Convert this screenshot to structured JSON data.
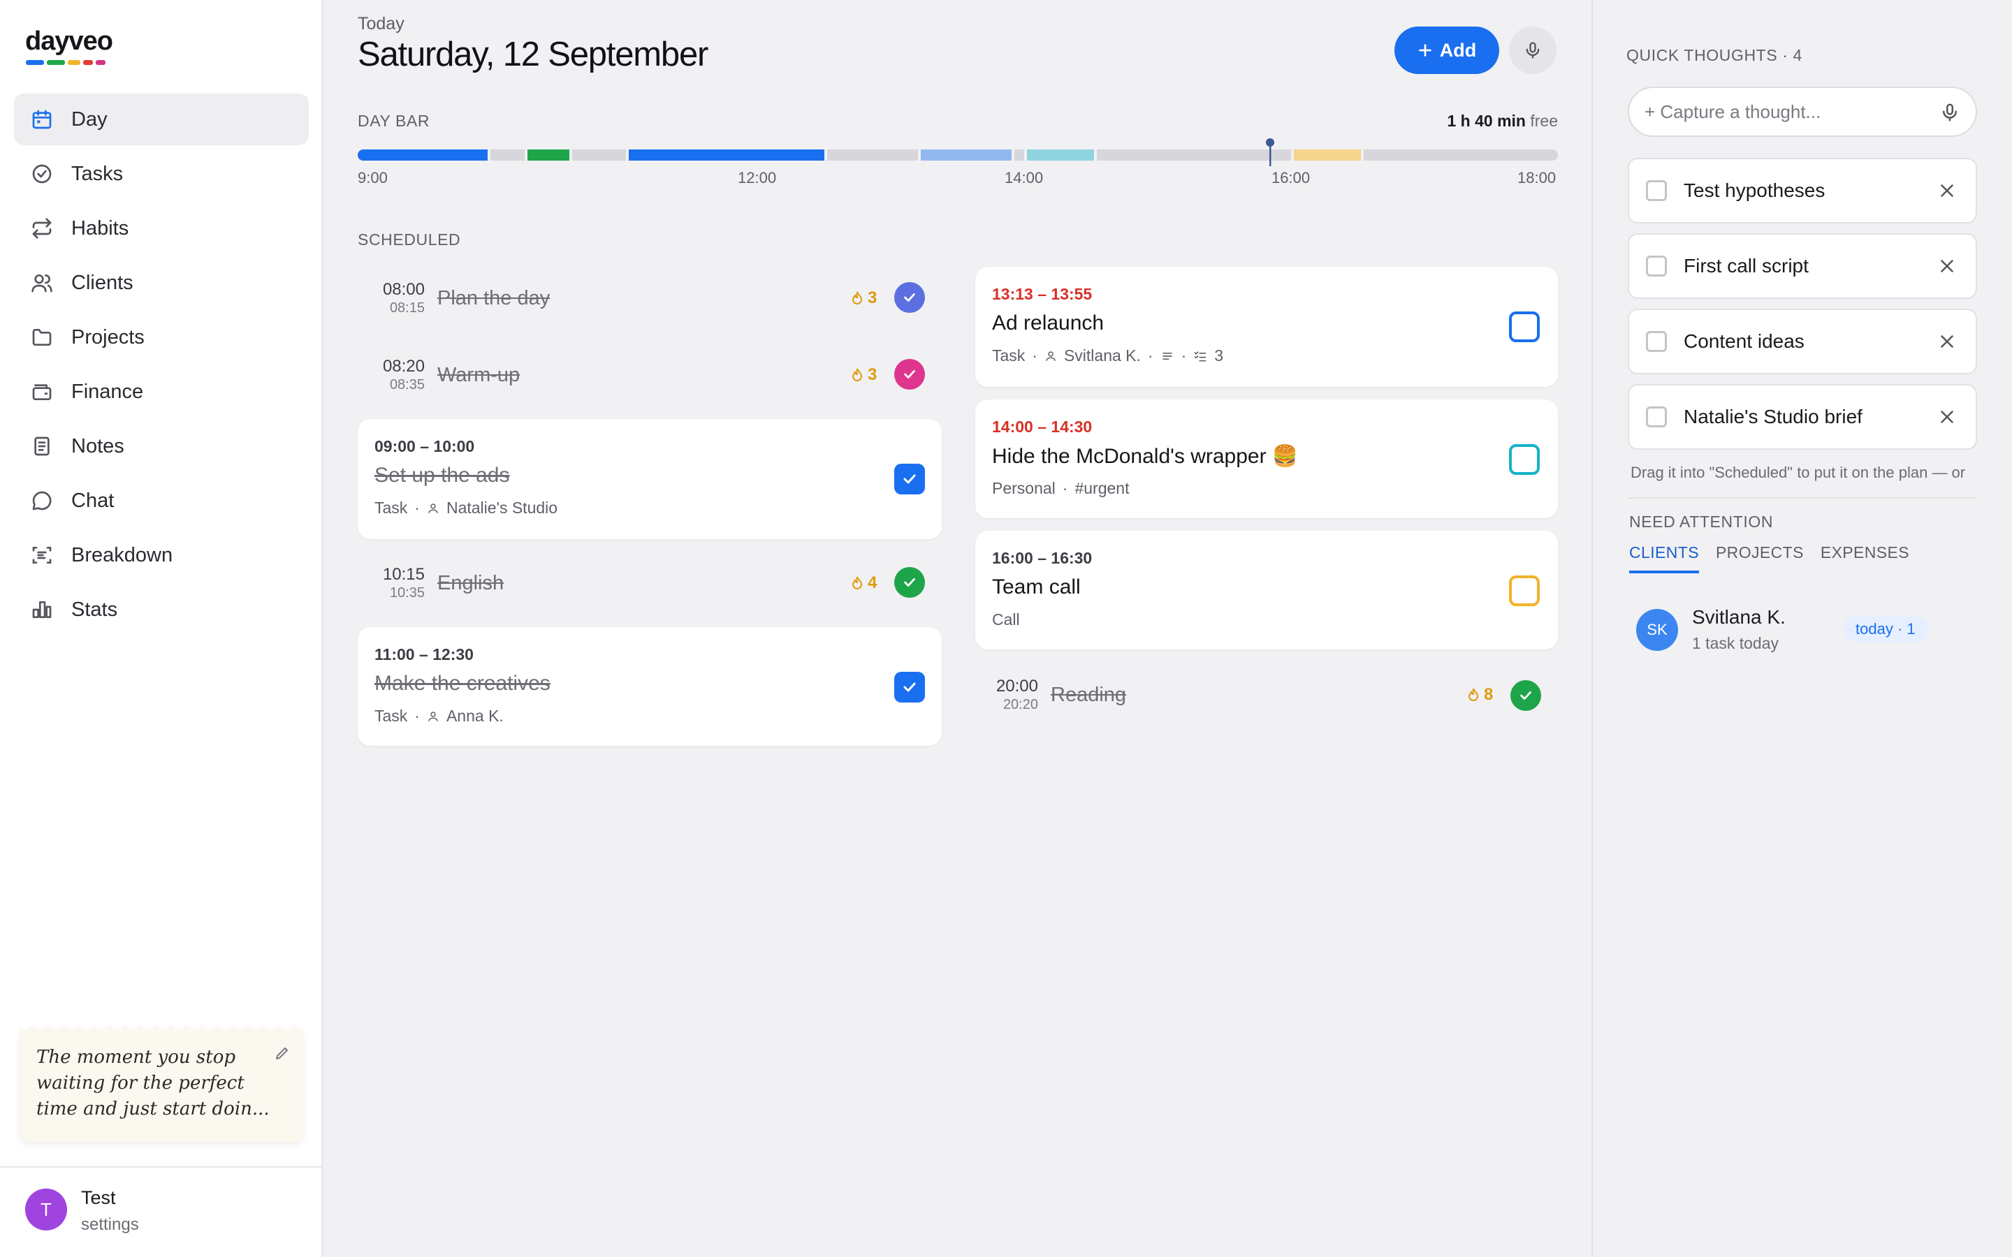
{
  "app": {
    "logo": "dayveo"
  },
  "colors": {
    "accent": "#1a6ff0",
    "done": "#1ea54a",
    "warn": "#f0b429",
    "urgent": "#d93025"
  },
  "sidebar": {
    "items": [
      {
        "label": "Day",
        "icon": "calendar-icon",
        "active": true
      },
      {
        "label": "Tasks",
        "icon": "check-circle-icon"
      },
      {
        "label": "Habits",
        "icon": "repeat-icon"
      },
      {
        "label": "Clients",
        "icon": "users-icon"
      },
      {
        "label": "Projects",
        "icon": "folder-icon"
      },
      {
        "label": "Finance",
        "icon": "wallet-icon"
      },
      {
        "label": "Notes",
        "icon": "note-icon"
      },
      {
        "label": "Chat",
        "icon": "chat-icon"
      },
      {
        "label": "Breakdown",
        "icon": "breakdown-icon"
      },
      {
        "label": "Stats",
        "icon": "bar-chart-icon"
      }
    ],
    "quote": "The moment you stop waiting for the perfect time and just start doin...",
    "user": {
      "initial": "T",
      "name": "Test",
      "link": "settings"
    }
  },
  "header": {
    "today_label": "Today",
    "date": "Saturday, 12 September",
    "add_label": "Add"
  },
  "daybar": {
    "label": "DAY BAR",
    "free_value": "1 h 40 min",
    "free_suffix": "free",
    "ticks": [
      "9:00",
      "12:00",
      "14:00",
      "16:00",
      "18:00"
    ]
  },
  "scheduled": {
    "label": "SCHEDULED",
    "left": {
      "habit_plan": {
        "start": "08:00",
        "end": "08:15",
        "title": "Plan the day",
        "streak": "3"
      },
      "habit_warmup": {
        "start": "08:20",
        "end": "08:35",
        "title": "Warm-up",
        "streak": "3"
      },
      "task_ads": {
        "time": "09:00 – 10:00",
        "title": "Set up the ads",
        "type": "Task",
        "client": "Natalie's Studio"
      },
      "habit_english": {
        "start": "10:15",
        "end": "10:35",
        "title": "English",
        "streak": "4"
      },
      "task_creatives": {
        "time": "11:00 – 12:30",
        "title": "Make the creatives",
        "type": "Task",
        "client": "Anna K."
      }
    },
    "right": {
      "task_relaunch": {
        "time": "13:13 – 13:55",
        "title": "Ad relaunch",
        "type": "Task",
        "client": "Svitlana K.",
        "subtasks": "3"
      },
      "task_wrapper": {
        "time": "14:00 – 14:30",
        "title": "Hide the McDonald's wrapper 🍔",
        "type": "Personal",
        "tag": "#urgent"
      },
      "task_call": {
        "time": "16:00 – 16:30",
        "title": "Team call",
        "type": "Call"
      },
      "habit_reading": {
        "start": "20:00",
        "end": "20:20",
        "title": "Reading",
        "streak": "8"
      }
    }
  },
  "quick_thoughts": {
    "label": "QUICK THOUGHTS · 4",
    "placeholder": "+ Capture a thought...",
    "items": [
      "Test hypotheses",
      "First call script",
      "Content ideas",
      "Natalie's Studio brief"
    ],
    "hint": "Drag it into \"Scheduled\" to put it on the plan — or"
  },
  "need_attention": {
    "label": "NEED ATTENTION",
    "tabs": [
      "CLIENTS",
      "PROJECTS",
      "EXPENSES"
    ],
    "client": {
      "initials": "SK",
      "name": "Svitlana K.",
      "sub": "1 task today",
      "badge": "today · 1"
    }
  }
}
